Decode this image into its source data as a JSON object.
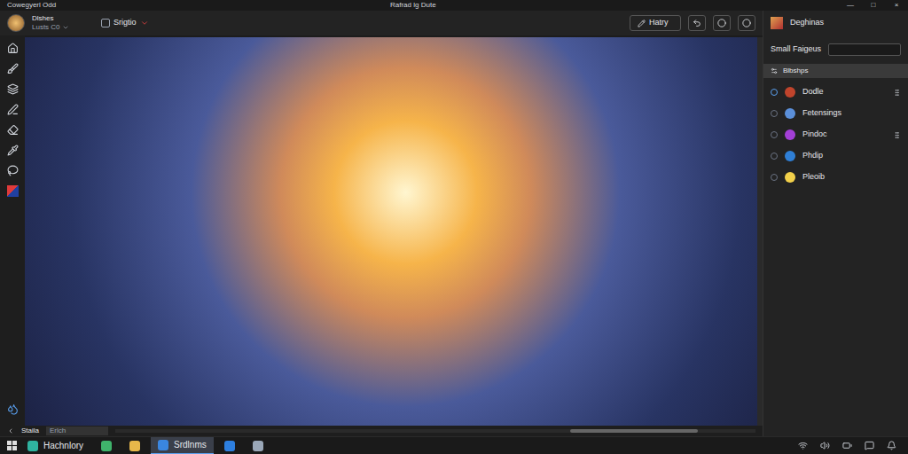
{
  "window": {
    "app": "Cowegyerl Odd",
    "title": "Rafrad lg Dute",
    "controls": [
      "—",
      "□",
      "×"
    ]
  },
  "toolbar": {
    "user": {
      "name": "Dlshes",
      "sub": "Lusts C0"
    },
    "dropdown": "Srigtio",
    "button": "Hatry"
  },
  "panel": {
    "title": "Deghinas",
    "field_label": "Small Faigeus",
    "field_value": "",
    "section": "Blbshps",
    "layers": [
      {
        "name": "Dodle",
        "color": "#c0442c",
        "selected": true,
        "pinned": true
      },
      {
        "name": "Fetensings",
        "color": "#5b8fd9",
        "selected": false,
        "pinned": false
      },
      {
        "name": "Pindoc",
        "color": "#a33fd6",
        "selected": false,
        "pinned": true
      },
      {
        "name": "Phdip",
        "color": "#2f7fd6",
        "selected": false,
        "pinned": false
      },
      {
        "name": "Pleoib",
        "color": "#f2d04a",
        "selected": false,
        "pinned": false
      }
    ]
  },
  "status": {
    "label": "Staila",
    "field": "Erlch",
    "scrollbar": {
      "offset": 0.71,
      "level": 0.2
    }
  },
  "taskbar": {
    "items": [
      {
        "kind": "labeled",
        "label": "Hachnlory",
        "color": "#2fb3a0",
        "selected": false
      },
      {
        "kind": "icon",
        "label": "",
        "color": "#3fb36b",
        "selected": false
      },
      {
        "kind": "icon",
        "label": "",
        "color": "#e8b84a",
        "selected": false
      },
      {
        "kind": "labeled",
        "label": "Srdlnms",
        "color": "#3a86e0",
        "selected": true
      },
      {
        "kind": "icon",
        "label": "",
        "color": "#2d7fe0",
        "selected": false
      },
      {
        "kind": "icon",
        "label": "",
        "color": "#9aa7b8",
        "selected": false
      }
    ]
  }
}
